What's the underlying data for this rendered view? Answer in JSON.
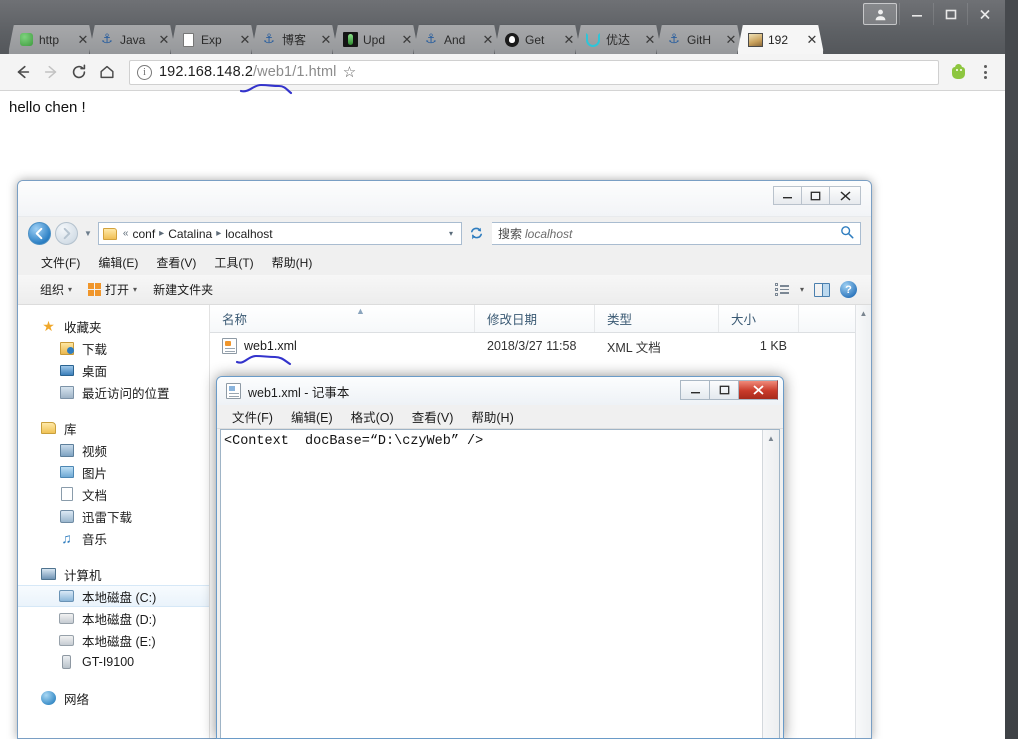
{
  "browser": {
    "window_controls": [
      {
        "name": "profile",
        "glyph": "👤"
      },
      {
        "name": "minimize",
        "glyph": "—"
      },
      {
        "name": "maximize",
        "glyph": "□"
      },
      {
        "name": "close",
        "glyph": "✕"
      }
    ],
    "tabs": [
      {
        "label": "http",
        "icon": "green-cube-icon",
        "active": false
      },
      {
        "label": "Java",
        "icon": "anchor-icon",
        "active": false
      },
      {
        "label": "Exp",
        "icon": "document-icon",
        "active": false
      },
      {
        "label": "博客",
        "icon": "anchor-icon",
        "active": false
      },
      {
        "label": "Upd",
        "icon": "dark-app-icon",
        "active": false
      },
      {
        "label": "And",
        "icon": "anchor-icon",
        "active": false
      },
      {
        "label": "Get",
        "icon": "github-icon",
        "active": false
      },
      {
        "label": "优达",
        "icon": "udacity-icon",
        "active": false
      },
      {
        "label": "GitH",
        "icon": "anchor-icon",
        "active": false
      },
      {
        "label": "192",
        "icon": "image-icon",
        "active": true
      }
    ],
    "tab_close_glyph": "✕",
    "toolbar": {
      "back": "←",
      "forward": "→",
      "reload": "⟳",
      "home": "⌂",
      "bookmark_star": "☆",
      "extension_icon": "android-extension-icon",
      "menu_dots": "three-dot-menu-icon"
    },
    "omnibox": {
      "info_glyph": "i",
      "url_host": "192.168.148.2",
      "url_path": "/web1/1.html"
    },
    "page": {
      "body_text": "hello chen !"
    }
  },
  "explorer": {
    "window_controls": [
      {
        "name": "minimize",
        "glyph": "—"
      },
      {
        "name": "maximize",
        "glyph": "□"
      },
      {
        "name": "close",
        "glyph": "✖"
      }
    ],
    "address": {
      "back_glyph": "←",
      "forward_glyph": "→",
      "overflow": "«",
      "crumbs": [
        "conf",
        "Catalina",
        "localhost"
      ],
      "separator": "▸",
      "dropdown_caret": "▾",
      "refresh_glyph": "↻"
    },
    "search": {
      "placeholder_prefix": "搜索",
      "placeholder_target": "localhost",
      "icon": "search-icon"
    },
    "menus": [
      "文件(F)",
      "编辑(E)",
      "查看(V)",
      "工具(T)",
      "帮助(H)"
    ],
    "toolbar": {
      "organize": "组织",
      "open": "打开",
      "new_folder": "新建文件夹",
      "caret": "▾",
      "view_icon": "view-options-icon",
      "pane_icon": "preview-pane-icon",
      "help_icon": "help-icon",
      "help_glyph": "?"
    },
    "sidebar": [
      {
        "label": "收藏夹",
        "icon": "favorites-star-icon",
        "level": "head",
        "selected": false
      },
      {
        "label": "下载",
        "icon": "downloads-icon",
        "level": "child",
        "selected": false
      },
      {
        "label": "桌面",
        "icon": "desktop-icon",
        "level": "child",
        "selected": false
      },
      {
        "label": "最近访问的位置",
        "icon": "recent-places-icon",
        "level": "child",
        "selected": false
      },
      {
        "label": "库",
        "icon": "library-icon",
        "level": "head",
        "selected": false
      },
      {
        "label": "视频",
        "icon": "video-icon",
        "level": "child",
        "selected": false
      },
      {
        "label": "图片",
        "icon": "pictures-icon",
        "level": "child",
        "selected": false
      },
      {
        "label": "文档",
        "icon": "documents-icon",
        "level": "child",
        "selected": false
      },
      {
        "label": "迅雷下载",
        "icon": "thunder-download-icon",
        "level": "child",
        "selected": false
      },
      {
        "label": "音乐",
        "icon": "music-icon",
        "level": "child",
        "selected": false
      },
      {
        "label": "计算机",
        "icon": "computer-icon",
        "level": "head",
        "selected": false
      },
      {
        "label": "本地磁盘 (C:)",
        "icon": "system-drive-icon",
        "level": "child",
        "selected": true
      },
      {
        "label": "本地磁盘 (D:)",
        "icon": "drive-icon",
        "level": "child",
        "selected": false
      },
      {
        "label": "本地磁盘 (E:)",
        "icon": "drive-icon",
        "level": "child",
        "selected": false
      },
      {
        "label": "GT-I9100",
        "icon": "phone-icon",
        "level": "child",
        "selected": false
      },
      {
        "label": "网络",
        "icon": "network-icon",
        "level": "head",
        "selected": false
      }
    ],
    "columns": [
      "名称",
      "修改日期",
      "类型",
      "大小"
    ],
    "sort_caret": "▲",
    "files": [
      {
        "name": "web1.xml",
        "modified": "2018/3/27 11:58",
        "type": "XML 文档",
        "size": "1 KB",
        "icon": "xml-file-icon"
      }
    ]
  },
  "notepad": {
    "title": "web1.xml - 记事本",
    "icon": "notepad-file-icon",
    "window_controls": [
      {
        "name": "minimize",
        "glyph": "—"
      },
      {
        "name": "maximize",
        "glyph": "□"
      },
      {
        "name": "close",
        "glyph": "✖"
      }
    ],
    "menus": [
      "文件(F)",
      "编辑(E)",
      "格式(O)",
      "查看(V)",
      "帮助(H)"
    ],
    "content": "<Context  docBase=“D:\\czyWeb” />",
    "scroll_up": "▲",
    "scroll_down": "▼"
  },
  "annotations": {
    "url_squiggle_color": "#3333cc",
    "file_squiggle_color": "#3333cc"
  }
}
